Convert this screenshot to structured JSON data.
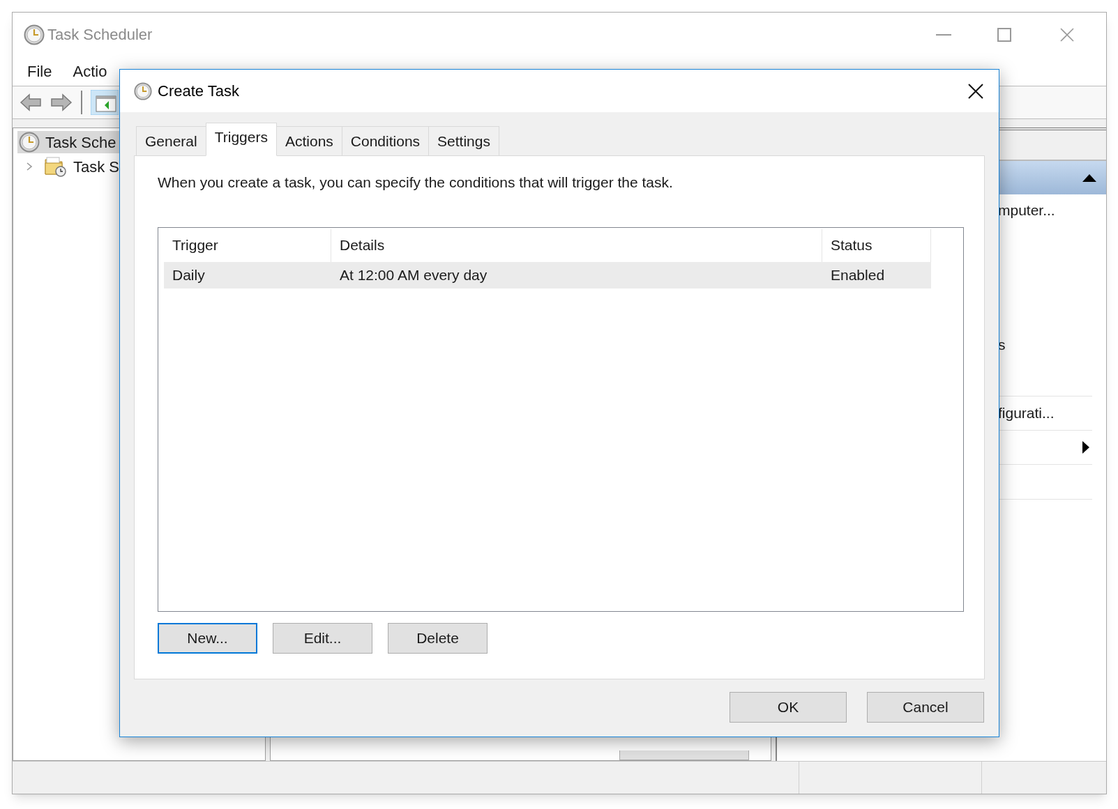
{
  "main_window": {
    "title": "Task Scheduler",
    "menu": [
      "File",
      "Actio"
    ],
    "tree": [
      {
        "label": "Task Sche",
        "selected": true,
        "children": [
          {
            "label": "Task S",
            "selected": false,
            "expanded": false
          }
        ]
      }
    ],
    "actions_pane": {
      "section_expanded": true,
      "groups": [
        {
          "items": [
            {
              "kind": "action",
              "label": "mputer..."
            },
            {
              "kind": "action",
              "label": "s"
            }
          ]
        },
        {
          "items": [
            {
              "kind": "action",
              "label": "figurati..."
            }
          ]
        },
        {
          "items": [
            {
              "kind": "submenu"
            }
          ]
        }
      ]
    }
  },
  "dialog": {
    "title": "Create Task",
    "tabs": [
      {
        "label": "General",
        "selected": false
      },
      {
        "label": "Triggers",
        "selected": true
      },
      {
        "label": "Actions",
        "selected": false
      },
      {
        "label": "Conditions",
        "selected": false
      },
      {
        "label": "Settings",
        "selected": false
      }
    ],
    "description": "When you create a task, you can specify the conditions that will trigger the task.",
    "triggers_table": {
      "columns": [
        "Trigger",
        "Details",
        "Status"
      ],
      "rows": [
        {
          "cells": [
            "Daily",
            "At 12:00 AM every day",
            "Enabled"
          ],
          "selected": true
        }
      ]
    },
    "buttons": [
      {
        "label": "New...",
        "default": true
      },
      {
        "label": "Edit...",
        "default": false
      },
      {
        "label": "Delete",
        "default": false
      }
    ],
    "footer_buttons": [
      {
        "label": "OK"
      },
      {
        "label": "Cancel"
      }
    ]
  }
}
